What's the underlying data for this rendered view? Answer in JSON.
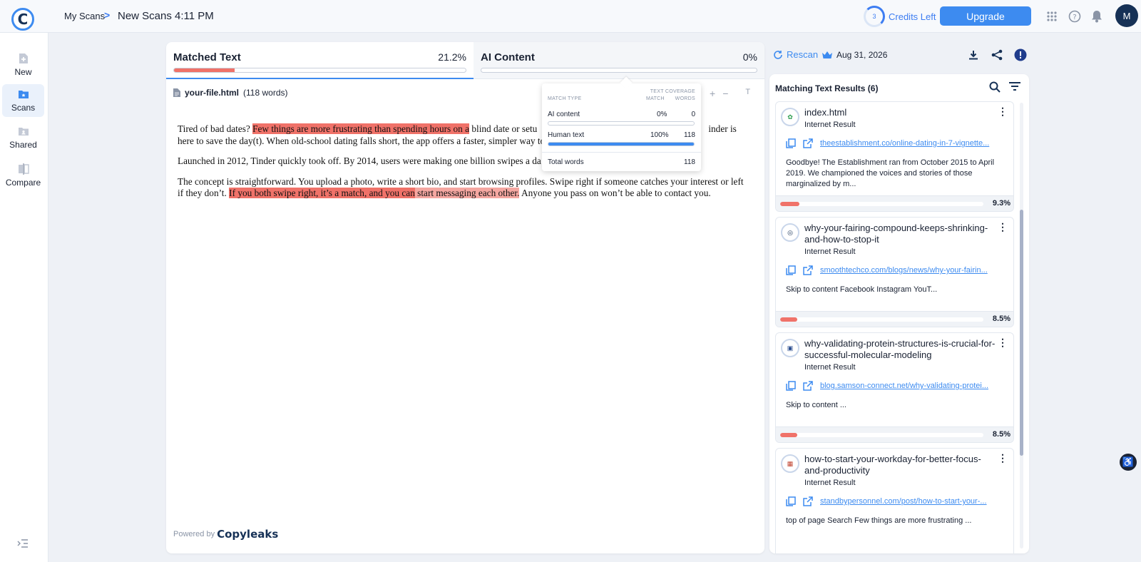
{
  "app": {
    "logo_letter": "C"
  },
  "breadcrumb": {
    "parent": "My Scans",
    "separator": ">",
    "current": "New Scans 4:11 PM"
  },
  "header": {
    "credits_count": "3",
    "credits_label": "Credits Left",
    "upgrade_label": "Upgrade",
    "avatar_initial": "M"
  },
  "sidebar": {
    "items": [
      {
        "label": "New",
        "icon": "new-file-icon"
      },
      {
        "label": "Scans",
        "icon": "scans-folder-icon",
        "active": true
      },
      {
        "label": "Shared",
        "icon": "shared-folder-icon"
      },
      {
        "label": "Compare",
        "icon": "compare-icon"
      }
    ]
  },
  "tabs": {
    "matched": {
      "title": "Matched Text",
      "percent": "21.2%",
      "fill": 0.212
    },
    "ai": {
      "title": "AI Content",
      "percent": "0%",
      "fill": 0
    }
  },
  "document": {
    "filename": "your-file.html",
    "word_count": "(118 words)",
    "p1": {
      "before": "Tired of bad dates? ",
      "hl1": "Few things are more frustrating than spending hours on a",
      "mid": " blind date or setu",
      "after": "inder is here to save the day(t). When old-school dating falls short, the app offers a faster, simpler way to me"
    },
    "p2": "Launched in 2012, Tinder quickly took off. By 2014, users were making one billion swipes a da",
    "p3": {
      "before": "The concept is straightforward. You upload a photo, write a short bio, and start browsing profiles. Swipe right if someone catches your interest or left if they don’t. ",
      "hl1": "If you both swipe right, it’s a match, and you can",
      "hl2": " start messaging each other.",
      "after": " Anyone you pass on won’t be able to contact you."
    },
    "powered_by": "Powered by",
    "brand": "Copyleaks"
  },
  "coverage_popup": {
    "col_match_type": "MATCH TYPE",
    "col_text_coverage": "TEXT COVERAGE",
    "col_match": "MATCH",
    "col_words": "WORDS",
    "rows": [
      {
        "label": "AI content",
        "match": "0%",
        "words": "0",
        "fill": 0
      },
      {
        "label": "Human text",
        "match": "100%",
        "words": "118",
        "fill": 1
      }
    ],
    "total_label": "Total words",
    "total_value": "118"
  },
  "right_toolbar": {
    "rescan_label": "Rescan",
    "date": "Aug 31, 2026"
  },
  "results": {
    "title": "Matching Text Results (6)",
    "items": [
      {
        "title": "index.html",
        "type": "Internet Result",
        "url": "theestablishment.co/online-dating-in-7-vignette...",
        "snippet": "Goodbye! The Establishment ran from October 2015 to April 2019. We championed the voices and stories of those marginalized by m...",
        "percent": "9.3%",
        "fill": 0.093
      },
      {
        "title": "why-your-fairing-compound-keeps-shrinking-and-how-to-stop-it",
        "type": "Internet Result",
        "url": "smoothtechco.com/blogs/news/why-your-fairin...",
        "snippet": "Skip to content Facebook Instagram YouT...",
        "percent": "8.5%",
        "fill": 0.085
      },
      {
        "title": "why-validating-protein-structures-is-crucial-for-successful-molecular-modeling",
        "type": "Internet Result",
        "url": "blog.samson-connect.net/why-validating-protei...",
        "snippet": "Skip to content ...",
        "percent": "8.5%",
        "fill": 0.085
      },
      {
        "title": "how-to-start-your-workday-for-better-focus-and-productivity",
        "type": "Internet Result",
        "url": "standbypersonnel.com/post/how-to-start-your-...",
        "snippet": "top of page Search Few things are more frustrating ...",
        "percent": "",
        "fill": 0
      }
    ]
  },
  "colors": {
    "accent": "#3d8bf0",
    "match_red": "#f07269",
    "match_light": "#f5a7a1",
    "navy": "#163156"
  }
}
